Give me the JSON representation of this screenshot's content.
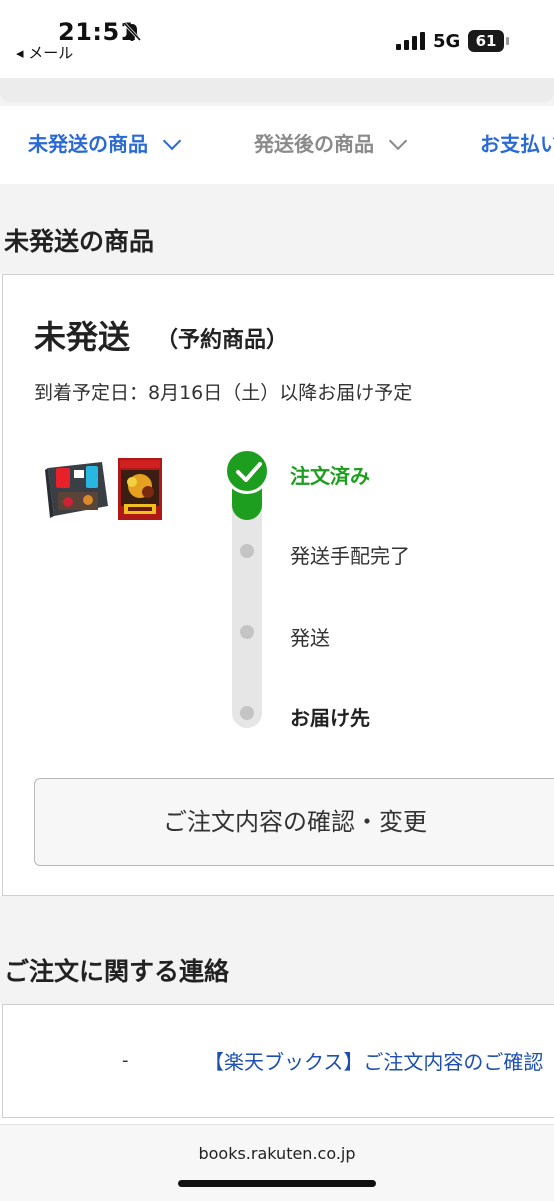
{
  "status_bar": {
    "time": "21:51",
    "back_label": "◂ メール",
    "network": "5G",
    "battery": "61"
  },
  "tabs": [
    {
      "label": "未発送の商品"
    },
    {
      "label": "発送後の商品"
    },
    {
      "label": "お支払い"
    }
  ],
  "section_unshipped": {
    "title": "未発送の商品"
  },
  "order": {
    "status": "未発送",
    "status_sub": "（予約商品）",
    "arrival": "到着予定日：8月16日（土）以降お届け予定",
    "steps": [
      {
        "label": "注文済み",
        "state": "done"
      },
      {
        "label": "発送手配完了",
        "state": "pending"
      },
      {
        "label": "発送",
        "state": "pending"
      },
      {
        "label": "お届け先",
        "state": "pending"
      }
    ],
    "progress_completed_steps": 1,
    "confirm_button": "ご注文内容の確認・変更"
  },
  "section_contact": {
    "title": "ご注文に関する連絡"
  },
  "contact": {
    "dash": "-",
    "link": "【楽天ブックス】ご注文内容のご確認"
  },
  "browser": {
    "url": "books.rakuten.co.jp"
  },
  "colors": {
    "accent_blue": "#2a6ad4",
    "done_green": "#1e9e1e",
    "link_blue": "#1d4fb3"
  }
}
